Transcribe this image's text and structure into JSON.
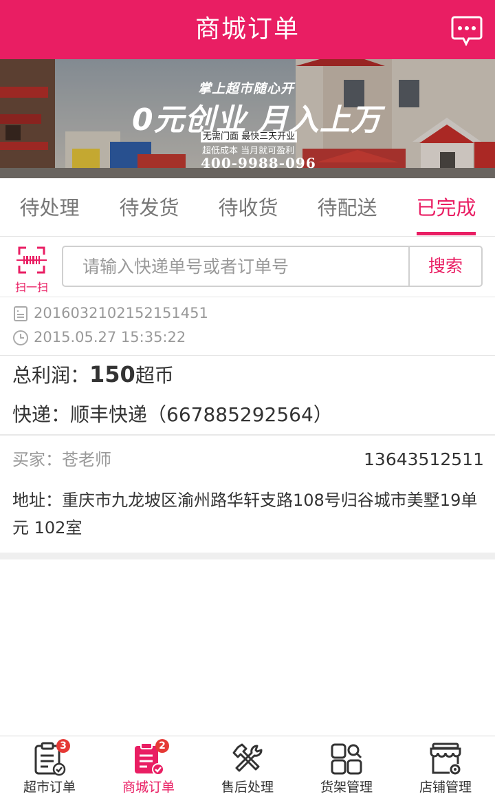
{
  "header": {
    "title": "商城订单",
    "message_icon": "chat-bubble-icon"
  },
  "banner": {
    "line1": "掌上超市随心开",
    "line2": "0元创业  月入上万",
    "line3": "无需门面 最快三天开业",
    "line4": "超低成本 当月就可盈利",
    "line5": "400-9988-096"
  },
  "tabs": [
    {
      "label": "待处理"
    },
    {
      "label": "待发货"
    },
    {
      "label": "待收货"
    },
    {
      "label": "待配送"
    },
    {
      "label": "已完成"
    }
  ],
  "active_tab": "已完成",
  "search": {
    "scan_label": "扫一扫",
    "placeholder": "请输入快递单号或者订单号",
    "value": "",
    "button_label": "搜索"
  },
  "order": {
    "number": "2016032102152151451",
    "time": "2015.05.27 15:35:22",
    "profit_prefix": "总利润：",
    "profit_value": "150",
    "profit_unit": "超币",
    "express": "快递：顺丰快递（667885292564）",
    "buyer": "买家：苍老师",
    "phone": "13643512511",
    "address": "地址：重庆市九龙坡区渝州路华轩支路108号归谷城市美墅19单元 102室"
  },
  "bottom_nav": [
    {
      "label": "超市订单",
      "icon": "clipboard-list-icon",
      "badge": "3"
    },
    {
      "label": "商城订单",
      "icon": "clipboard-check-icon",
      "badge": "2"
    },
    {
      "label": "售后处理",
      "icon": "wrench-screwdriver-icon",
      "badge": ""
    },
    {
      "label": "货架管理",
      "icon": "grid-search-icon",
      "badge": ""
    },
    {
      "label": "店铺管理",
      "icon": "store-gear-icon",
      "badge": ""
    }
  ],
  "colors": {
    "primary": "#e91e63",
    "badge": "#e53935",
    "text": "#333333",
    "muted": "#999999"
  }
}
